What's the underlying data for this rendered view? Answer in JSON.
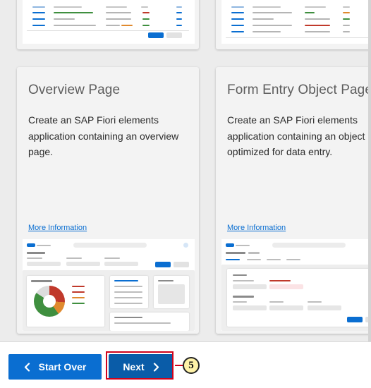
{
  "tiles": [
    {
      "title": "Overview Page",
      "description": "Create an SAP Fiori elements\napplication containing an overview\npage.",
      "link": "More Information"
    },
    {
      "title": "Form Entry Object Page",
      "description": "Create an SAP Fiori elements\napplication containing an object\noptimized for data entry.",
      "link": "More Information"
    }
  ],
  "footer": {
    "start_over_label": "Start Over",
    "next_label": "Next"
  },
  "callout": {
    "number": "5"
  },
  "icons": {
    "start_over": "chevron-left-icon",
    "next": "chevron-right-icon"
  },
  "colors": {
    "primary_button": "#0a6ed1",
    "next_button": "#0a5ca8",
    "highlight": "#d0021b",
    "callout_fill": "#fff3a8",
    "link": "#0a6ed1"
  }
}
